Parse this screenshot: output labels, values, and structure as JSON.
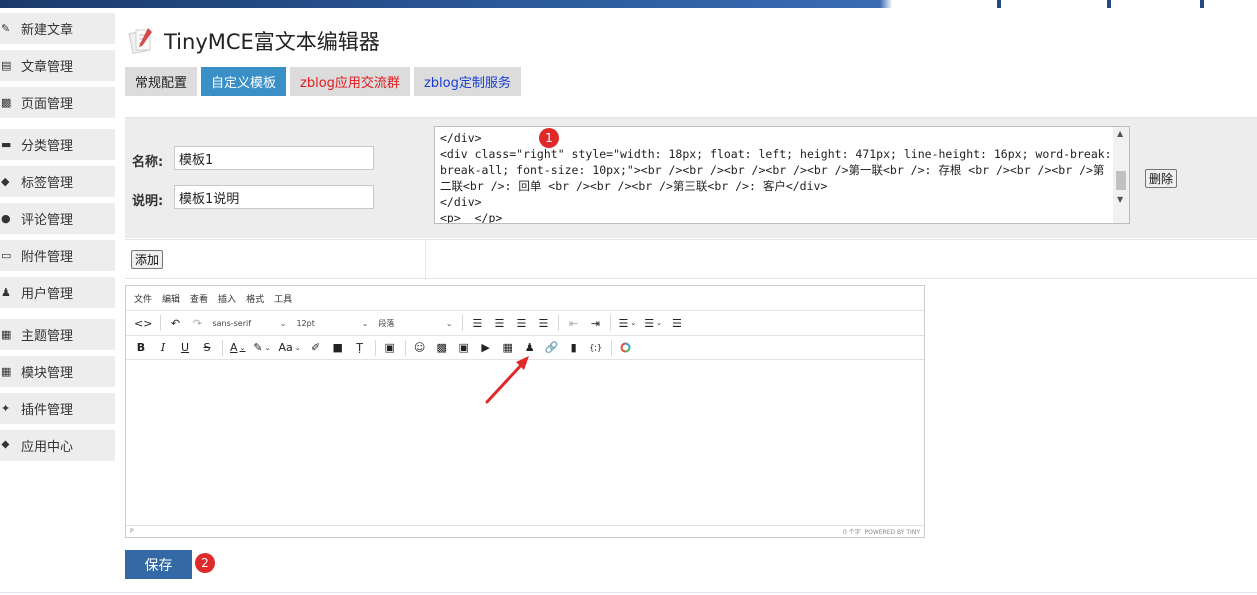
{
  "sidebar": {
    "items": [
      {
        "label": "新建文章",
        "icon": "pencil-square-icon"
      },
      {
        "label": "文章管理",
        "icon": "document-list-icon"
      },
      {
        "label": "页面管理",
        "icon": "page-icon"
      },
      {
        "label": "分类管理",
        "icon": "folder-icon"
      },
      {
        "label": "标签管理",
        "icon": "tag-icon"
      },
      {
        "label": "评论管理",
        "icon": "comment-icon"
      },
      {
        "label": "附件管理",
        "icon": "inbox-icon"
      },
      {
        "label": "用户管理",
        "icon": "users-icon"
      },
      {
        "label": "主题管理",
        "icon": "layout-icon"
      },
      {
        "label": "模块管理",
        "icon": "grid-icon"
      },
      {
        "label": "插件管理",
        "icon": "puzzle-icon"
      },
      {
        "label": "应用中心",
        "icon": "box-icon"
      }
    ]
  },
  "header": {
    "title": "TinyMCE富文本编辑器"
  },
  "tabs": [
    {
      "label": "常规配置"
    },
    {
      "label": "自定义模板"
    },
    {
      "label": "zblog应用交流群"
    },
    {
      "label": "zblog定制服务"
    }
  ],
  "form": {
    "name_label": "名称:",
    "name_value": "模板1",
    "desc_label": "说明:",
    "desc_value": "模板1说明",
    "code": "</div>\n<div class=\"right\" style=\"width: 18px; float: left; height: 471px; line-height: 16px; word-break: break-all; font-size: 10px;\"><br /><br /><br /><br /><br />第一联<br />: 存根 <br /><br /><br />第二联<br />: 回单 <br /><br /><br />第三联<br />: 客户</div>\n</div>\n<p>  </p>",
    "delete_label": "删除",
    "add_label": "添加"
  },
  "badges": {
    "one": "1",
    "two": "2"
  },
  "editor": {
    "menus": [
      "文件",
      "编辑",
      "查看",
      "插入",
      "格式",
      "工具"
    ],
    "font_family": "sans-serif",
    "font_size": "12pt",
    "block_format": "段落",
    "status_path": "P",
    "word_count": "0 个字",
    "powered_by": "POWERED BY TINY"
  },
  "save_label": "保存",
  "colors": {
    "accent": "#3a8fc7",
    "save": "#336aa5",
    "badge": "#e02a2a",
    "arrow": "#e02a2a"
  }
}
